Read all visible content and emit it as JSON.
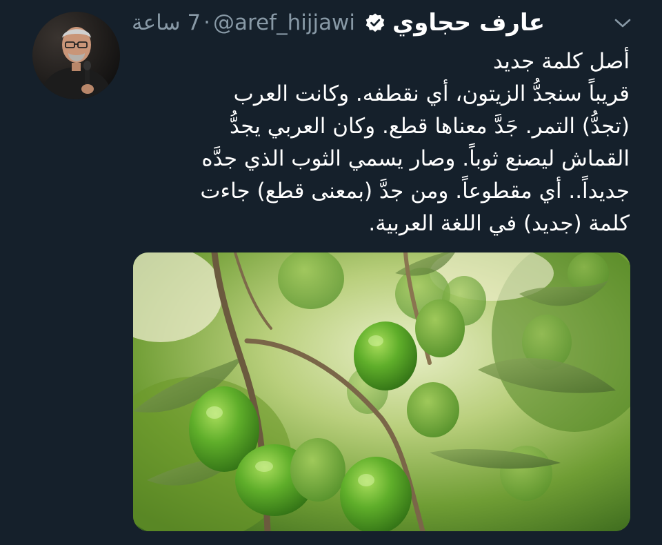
{
  "tweet": {
    "author_name": "عارف حجاوي",
    "handle": "@aref_hijjawi",
    "separator": "·",
    "time": "7 ساعة",
    "text_lines": [
      "أصل كلمة جديد",
      "قريباً سنجدُّ الزيتون، أي نقطفه. وكانت العرب",
      "(تجدُّ) التمر. جَدَّ معناها قطع. وكان العربي يجدُّ",
      "القماش ليصنع ثوباً. وصار يسمي الثوب الذي جدَّه",
      "جديداً.. أي مقطوعاً. ومن جدَّ (بمعنى قطع) جاءت",
      "كلمة (جديد) في اللغة العربية."
    ]
  },
  "icons": {
    "caret": "chevron-down-icon",
    "verified": "verified-badge-icon"
  },
  "colors": {
    "background": "#15202b",
    "secondary_text": "#8899a6",
    "primary_text": "#ffffff",
    "olive_green": "#5faa2c"
  }
}
